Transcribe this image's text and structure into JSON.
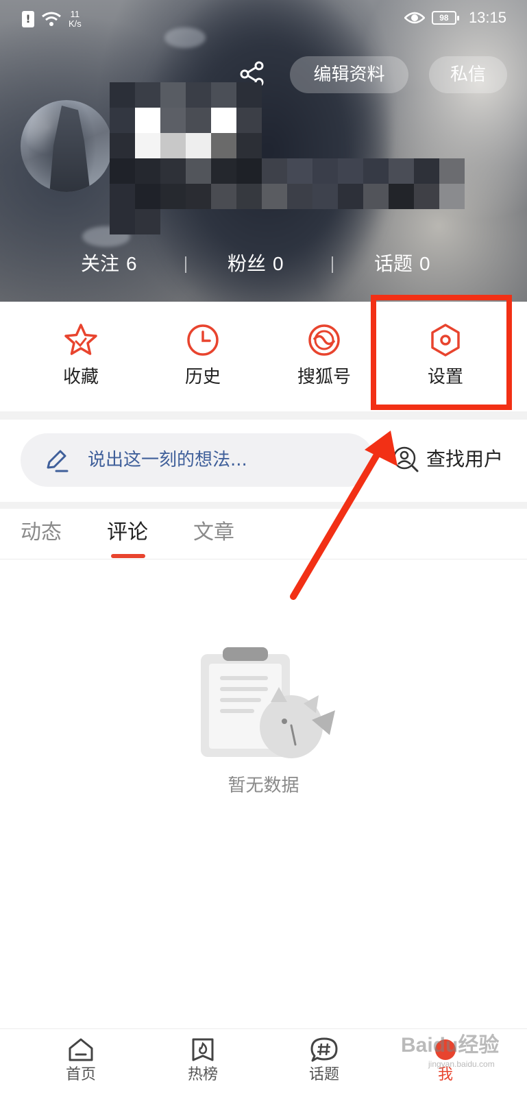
{
  "status_bar": {
    "net_speed": "11",
    "net_speed_unit": "K/s",
    "battery": "98",
    "time": "13:15"
  },
  "profile": {
    "edit_label": "编辑资料",
    "message_label": "私信",
    "stats": [
      {
        "label": "关注",
        "value": "6"
      },
      {
        "label": "粉丝",
        "value": "0"
      },
      {
        "label": "话题",
        "value": "0"
      }
    ]
  },
  "quick_actions": [
    {
      "label": "收藏",
      "icon": "star-icon"
    },
    {
      "label": "历史",
      "icon": "clock-icon"
    },
    {
      "label": "搜狐号",
      "icon": "sohu-icon"
    },
    {
      "label": "设置",
      "icon": "hexagon-settings-icon"
    }
  ],
  "composer": {
    "placeholder": "说出这一刻的想法...",
    "find_user_label": "查找用户"
  },
  "tabs": [
    {
      "label": "动态",
      "active": false
    },
    {
      "label": "评论",
      "active": true
    },
    {
      "label": "文章",
      "active": false
    }
  ],
  "empty_state": {
    "message": "暂无数据"
  },
  "bottom_nav": [
    {
      "label": "首页",
      "icon": "home-icon",
      "active": false
    },
    {
      "label": "热榜",
      "icon": "hot-list-icon",
      "active": false
    },
    {
      "label": "话题",
      "icon": "hashtag-icon",
      "active": false
    },
    {
      "label": "我",
      "icon": "me-icon",
      "active": true
    }
  ],
  "watermark": {
    "brand": "Baidu",
    "suffix": "经验",
    "domain": "jingyan.baidu.com"
  },
  "colors": {
    "accent": "#e8442e",
    "annotation_red": "#f23015",
    "link_blue": "#3f5f9a"
  }
}
